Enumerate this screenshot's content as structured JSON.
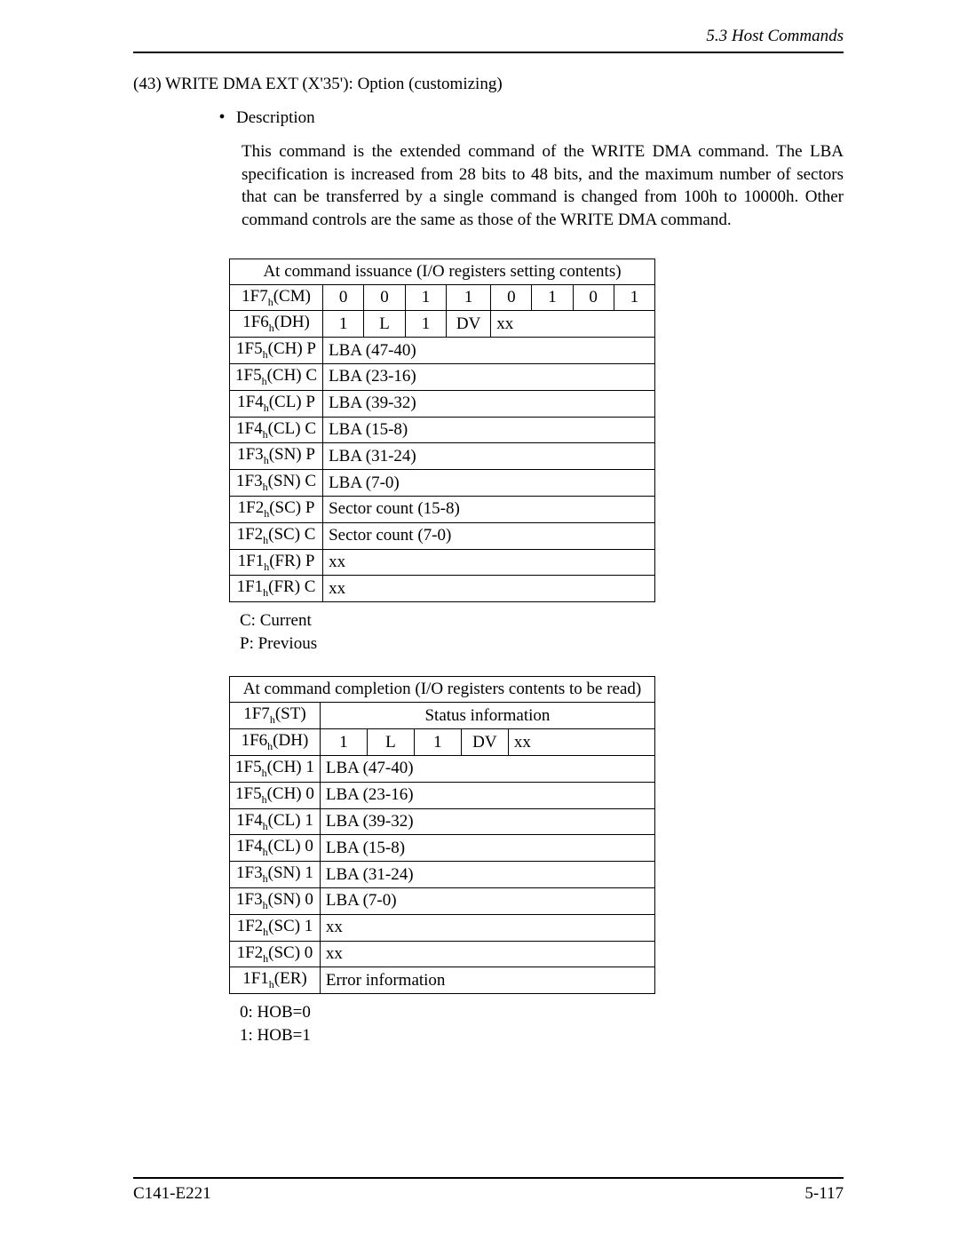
{
  "header": {
    "section": "5.3  Host Commands"
  },
  "title": "(43)  WRITE DMA EXT (X'35'):  Option (customizing)",
  "description_label": "Description",
  "body": "This command is the extended command of the WRITE DMA command.  The LBA specification is increased from 28 bits to 48 bits, and the maximum number of sectors that can be transferred by a single command is changed from 100h to 10000h.  Other command controls are the same as those of the WRITE DMA command.",
  "table1": {
    "title": "At command issuance (I/O registers setting contents)",
    "rows": {
      "cm": {
        "label": "1F7",
        "sub": "h",
        "paren": "(CM)",
        "bits": [
          "0",
          "0",
          "1",
          "1",
          "0",
          "1",
          "0",
          "1"
        ]
      },
      "dh": {
        "label": "1F6",
        "sub": "h",
        "paren": "(DH)",
        "cells": [
          "1",
          "L",
          "1",
          "DV",
          "xx"
        ]
      },
      "ch_p": {
        "label": "1F5",
        "sub": "h",
        "paren": "(CH) P",
        "full": "LBA (47-40)"
      },
      "ch_c": {
        "label": "1F5",
        "sub": "h",
        "paren": "(CH) C",
        "full": "LBA (23-16)"
      },
      "cl_p": {
        "label": "1F4",
        "sub": "h",
        "paren": "(CL) P",
        "full": "LBA (39-32)"
      },
      "cl_c": {
        "label": "1F4",
        "sub": "h",
        "paren": "(CL) C",
        "full": "LBA (15-8)"
      },
      "sn_p": {
        "label": "1F3",
        "sub": "h",
        "paren": "(SN) P",
        "full": "LBA (31-24)"
      },
      "sn_c": {
        "label": "1F3",
        "sub": "h",
        "paren": "(SN) C",
        "full": "LBA (7-0)"
      },
      "sc_p": {
        "label": "1F2",
        "sub": "h",
        "paren": "(SC) P",
        "full": "Sector count (15-8)"
      },
      "sc_c": {
        "label": "1F2",
        "sub": "h",
        "paren": "(SC) C",
        "full": "Sector count (7-0)"
      },
      "fr_p": {
        "label": "1F1",
        "sub": "h",
        "paren": "(FR) P",
        "full": "xx"
      },
      "fr_c": {
        "label": "1F1",
        "sub": "h",
        "paren": "(FR) C",
        "full": "xx"
      }
    },
    "legend": [
      "C:  Current",
      "P:  Previous"
    ]
  },
  "table2": {
    "title": "At command completion (I/O registers contents to be read)",
    "rows": {
      "st": {
        "label": "1F7",
        "sub": "h",
        "paren": "(ST)",
        "status": "Status information"
      },
      "dh": {
        "label": "1F6",
        "sub": "h",
        "paren": "(DH)",
        "cells": [
          "1",
          "L",
          "1",
          "DV",
          "xx"
        ]
      },
      "ch_1": {
        "label": "1F5",
        "sub": "h",
        "paren": "(CH) 1",
        "full": "LBA (47-40)"
      },
      "ch_0": {
        "label": "1F5",
        "sub": "h",
        "paren": "(CH) 0",
        "full": "LBA (23-16)"
      },
      "cl_1": {
        "label": "1F4",
        "sub": "h",
        "paren": "(CL) 1",
        "full": "LBA (39-32)"
      },
      "cl_0": {
        "label": "1F4",
        "sub": "h",
        "paren": "(CL) 0",
        "full": "LBA (15-8)"
      },
      "sn_1": {
        "label": "1F3",
        "sub": "h",
        "paren": "(SN) 1",
        "full": "LBA (31-24)"
      },
      "sn_0": {
        "label": "1F3",
        "sub": "h",
        "paren": "(SN) 0",
        "full": "LBA (7-0)"
      },
      "sc_1": {
        "label": "1F2",
        "sub": "h",
        "paren": "(SC) 1",
        "full": "xx"
      },
      "sc_0": {
        "label": "1F2",
        "sub": "h",
        "paren": "(SC) 0",
        "full": "xx"
      },
      "er": {
        "label": "1F1",
        "sub": "h",
        "paren": "(ER)",
        "full": "Error information"
      }
    },
    "legend": [
      "0:  HOB=0",
      "1:  HOB=1"
    ]
  },
  "footer": {
    "left": "C141-E221",
    "right": "5-117"
  }
}
